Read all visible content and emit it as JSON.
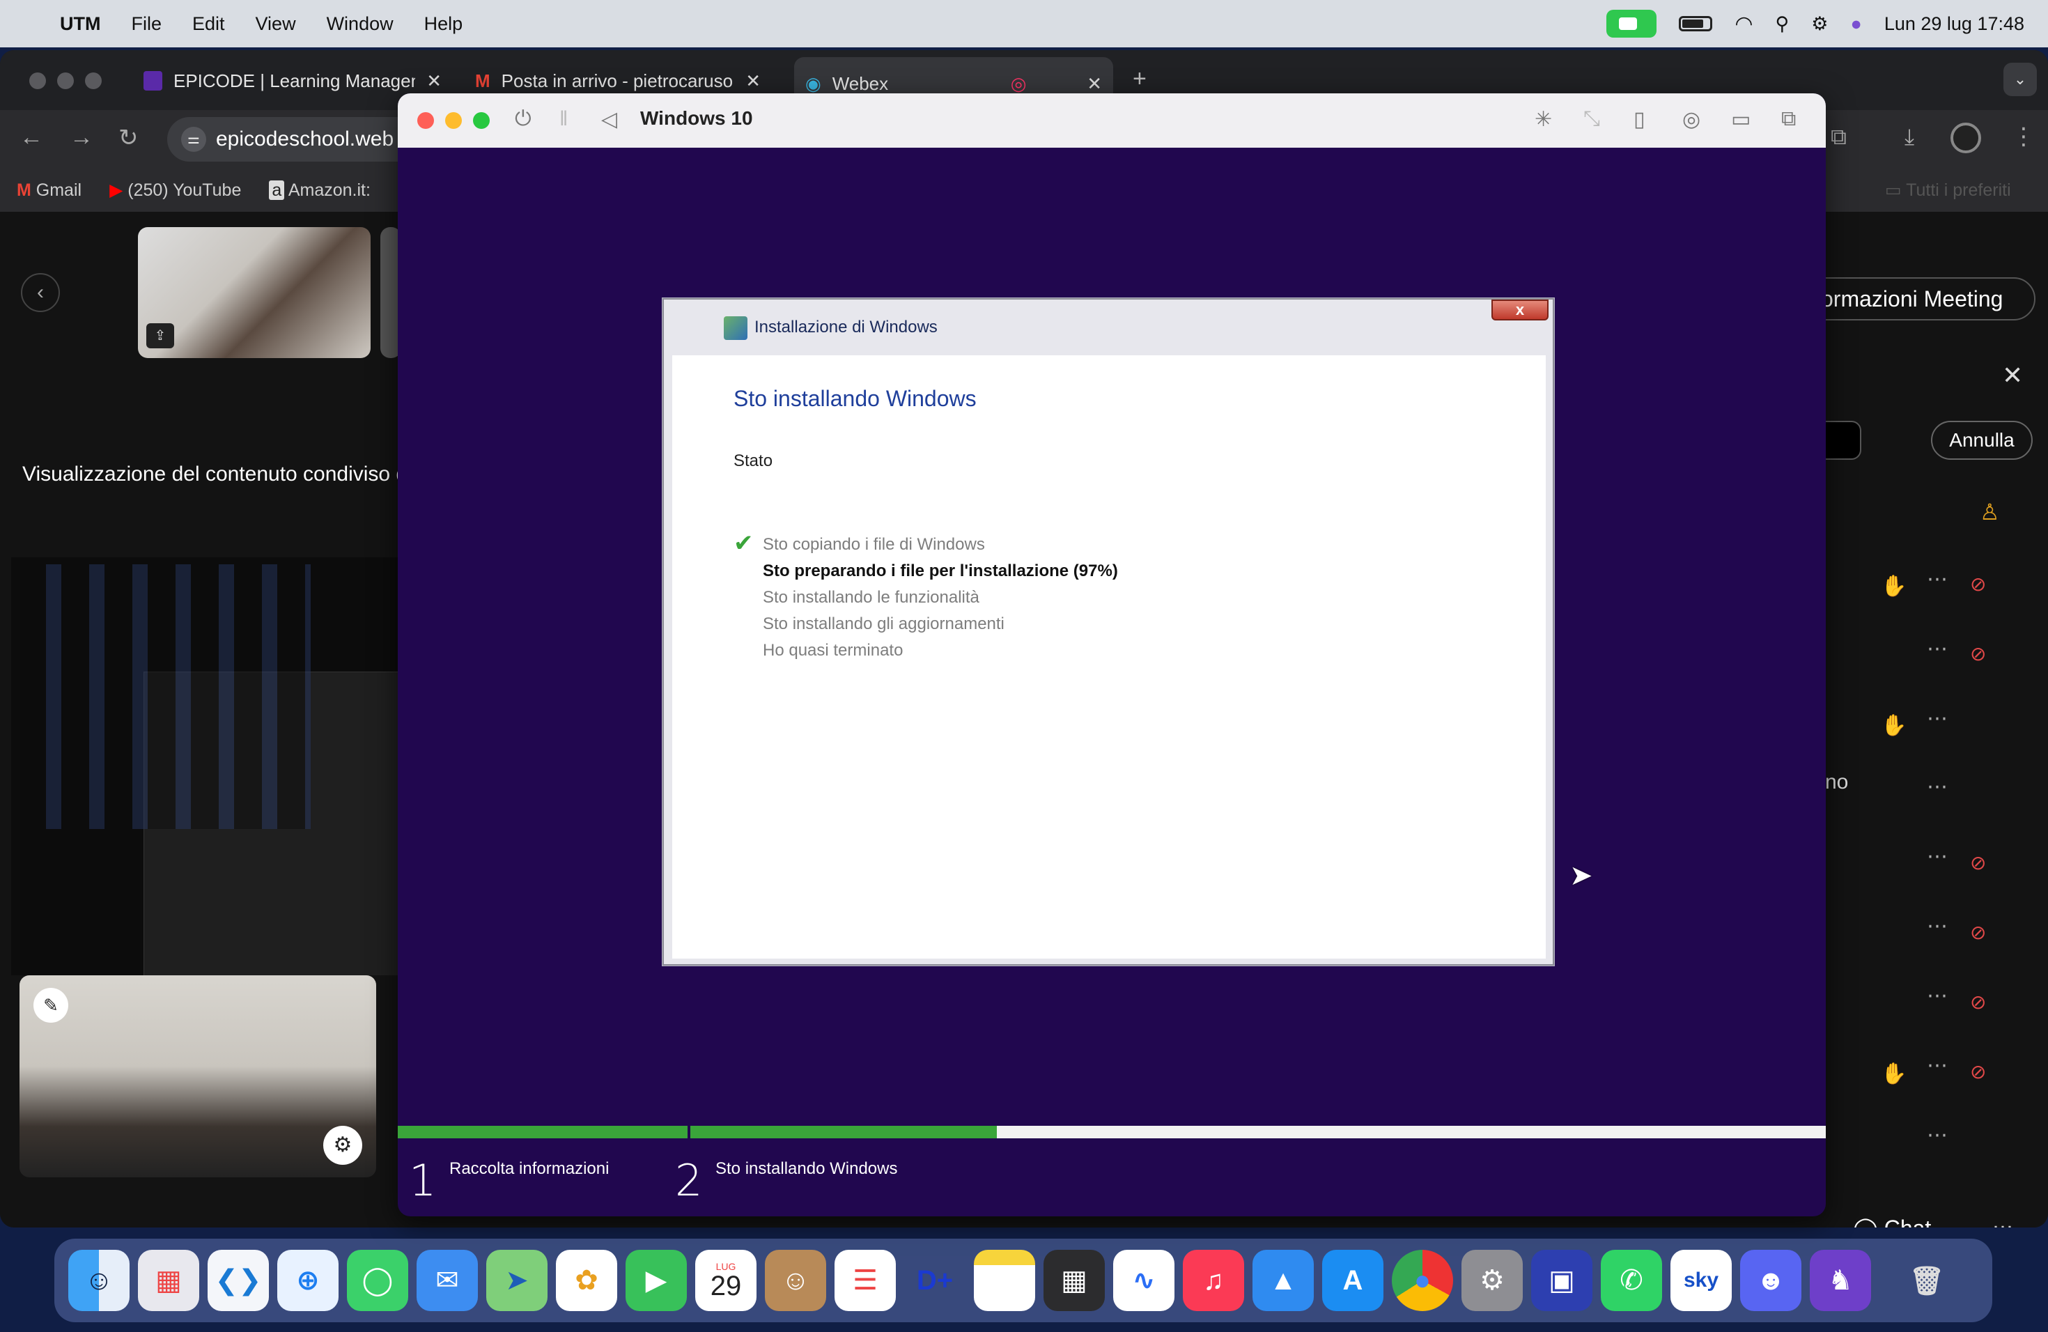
{
  "menubar": {
    "app_name": "UTM",
    "items": [
      "File",
      "Edit",
      "View",
      "Window",
      "Help"
    ],
    "datetime": "Lun 29 lug  17:48"
  },
  "browser": {
    "tabs": [
      {
        "title": "EPICODE | Learning Managem",
        "icon": "epicode-icon"
      },
      {
        "title": "Posta in arrivo - pietrocaruso",
        "icon": "gmail-icon"
      },
      {
        "title": "Webex",
        "icon": "webex-icon"
      }
    ],
    "url": "epicodeschool.web",
    "bookmarks": [
      "Gmail",
      "(250) YouTube",
      "Amazon.it:"
    ],
    "bookmarks_right": "Tutti i preferiti"
  },
  "webex": {
    "shared_label": "Visualizzazione del contenuto condiviso d",
    "meeting_info": "ormazioni Meeting",
    "annulla": "Annulla",
    "partial_text": "no",
    "chat": "Chat"
  },
  "utm": {
    "title": "Windows 10"
  },
  "setup": {
    "window_title": "Installazione di Windows",
    "close_label": "x",
    "heading": "Sto installando Windows",
    "status_label": "Stato",
    "steps": [
      "Sto copiando i file di Windows",
      "Sto preparando i file per l'installazione (97%)",
      "Sto installando le funzionalità",
      "Sto installando gli aggiornamenti",
      "Ho quasi terminato"
    ],
    "completed_steps": 1,
    "active_step": 1
  },
  "progress": {
    "phase1_num": "1",
    "phase1_label": "Raccolta informazioni",
    "phase2_num": "2",
    "phase2_label": "Sto installando Windows",
    "phase2_fraction": 0.27
  },
  "dock": {
    "calendar_month": "LUG",
    "calendar_day": "29"
  }
}
